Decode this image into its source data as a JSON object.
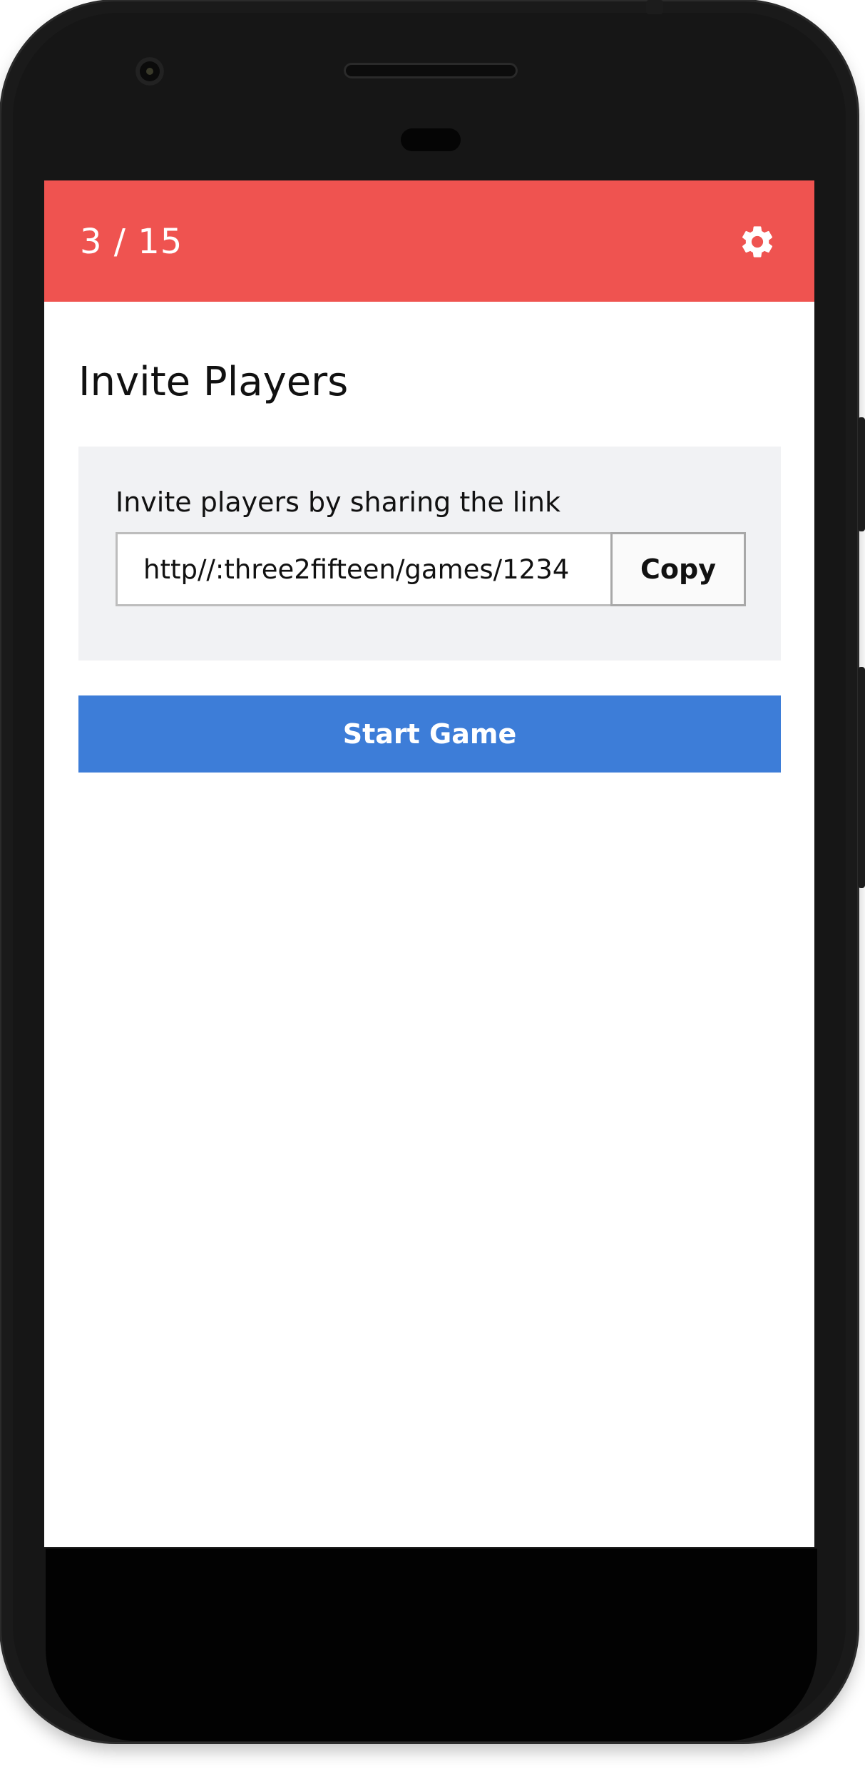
{
  "header": {
    "counter": "3 / 15",
    "settings_icon": "gear-icon",
    "color": "#ef5350"
  },
  "page": {
    "title": "Invite Players"
  },
  "invite": {
    "label": "Invite players by sharing the link",
    "link_value": "http//:three2fifteen/games/1234",
    "copy_label": "Copy"
  },
  "actions": {
    "start_label": "Start Game",
    "start_color": "#3d7dd8"
  }
}
